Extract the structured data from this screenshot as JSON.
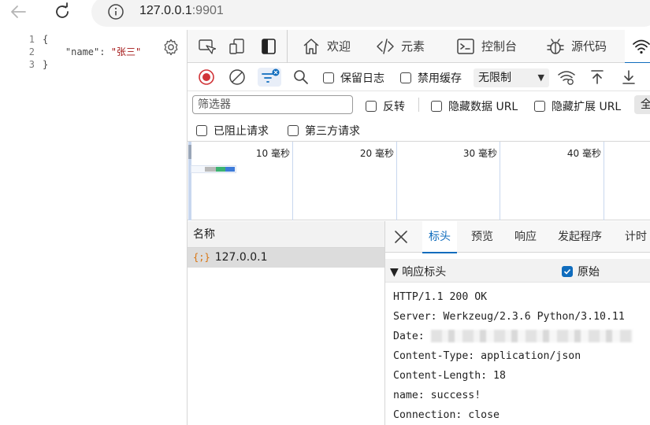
{
  "browser": {
    "url_host": "127.0.0.1",
    "url_port": ":9901"
  },
  "page": {
    "gutter": [
      "1",
      "2",
      "3"
    ],
    "json_lines": [
      "{",
      "}"
    ],
    "json_key": "\"name\"",
    "json_colon": ": ",
    "json_value": "\"张三\""
  },
  "devtools": {
    "tabs": [
      {
        "label": "欢迎",
        "icon": "home-icon"
      },
      {
        "label": "元素",
        "icon": "code-icon"
      },
      {
        "label": "控制台",
        "icon": "console-icon"
      },
      {
        "label": "源代码",
        "icon": "bug-icon"
      }
    ],
    "active_tab_icon": "wifi-icon",
    "network": {
      "preserve_log": "保留日志",
      "disable_cache": "禁用缓存",
      "throttle": "无限制",
      "filter_placeholder": "筛选器",
      "invert": "反转",
      "hide_data_urls": "隐藏数据 URL",
      "hide_ext_urls": "隐藏扩展 URL",
      "type_all": "全",
      "blocked_requests": "已阻止请求",
      "third_party": "第三方请求",
      "timeline_labels": [
        "10 毫秒",
        "20 毫秒",
        "30 毫秒",
        "40 毫秒"
      ],
      "name_column": "名称",
      "requests": [
        {
          "name": "127.0.0.1",
          "type_icon": "json-icon"
        }
      ]
    },
    "detail": {
      "tabs": [
        "标头",
        "预览",
        "响应",
        "发起程序",
        "计时"
      ],
      "active_tab": "标头",
      "section_title": "▼ 响应标头",
      "raw_label": "原始",
      "raw_checked": true,
      "headers": [
        "HTTP/1.1 200 OK",
        "Server: Werkzeug/2.3.6 Python/3.10.11",
        "Date: ",
        "Content-Type: application/json",
        "Content-Length: 18",
        "name: success!",
        "Connection: close"
      ]
    }
  },
  "colors": {
    "accent": "#0f6cbd",
    "record": "#d13438",
    "json_string": "#a31515"
  }
}
